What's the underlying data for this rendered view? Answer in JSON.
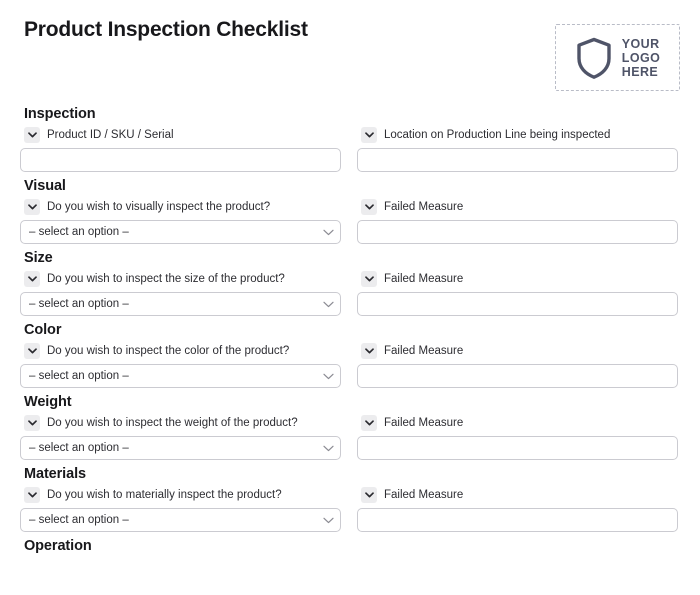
{
  "document": {
    "title": "Product Inspection Checklist"
  },
  "logo": {
    "icon": "shield-icon",
    "line1": "YOUR",
    "line2": "LOGO",
    "line3": "HERE",
    "color": "#4f5468",
    "border_color": "#b9bcc7"
  },
  "icons": {
    "field_toggle": "chevron-down-icon",
    "select_caret": "chevron-down-icon"
  },
  "select_placeholder": "– select an option –",
  "sections": [
    {
      "heading": "Inspection",
      "left": {
        "label": "Product ID / SKU / Serial",
        "control": "text",
        "value": "",
        "placeholder": ""
      },
      "right": {
        "label": "Location on Production Line being inspected",
        "control": "text",
        "value": "",
        "placeholder": ""
      }
    },
    {
      "heading": "Visual",
      "left": {
        "label": "Do you wish to visually inspect the product?",
        "control": "select",
        "value": "– select an option –"
      },
      "right": {
        "label": "Failed Measure",
        "control": "text",
        "value": "",
        "placeholder": ""
      }
    },
    {
      "heading": "Size",
      "left": {
        "label": "Do you wish to inspect the size of the product?",
        "control": "select",
        "value": "– select an option –"
      },
      "right": {
        "label": "Failed Measure",
        "control": "text",
        "value": "",
        "placeholder": ""
      }
    },
    {
      "heading": "Color",
      "left": {
        "label": "Do you wish to inspect the color of the product?",
        "control": "select",
        "value": "– select an option –"
      },
      "right": {
        "label": "Failed Measure",
        "control": "text",
        "value": "",
        "placeholder": ""
      }
    },
    {
      "heading": "Weight",
      "left": {
        "label": "Do you wish to inspect the weight of the product?",
        "control": "select",
        "value": "– select an option –"
      },
      "right": {
        "label": "Failed Measure",
        "control": "text",
        "value": "",
        "placeholder": ""
      }
    },
    {
      "heading": "Materials",
      "left": {
        "label": "Do you wish to materially inspect the product?",
        "control": "select",
        "value": "– select an option –"
      },
      "right": {
        "label": "Failed Measure",
        "control": "text",
        "value": "",
        "placeholder": ""
      }
    },
    {
      "heading": "Operation",
      "left": null,
      "right": null
    }
  ]
}
